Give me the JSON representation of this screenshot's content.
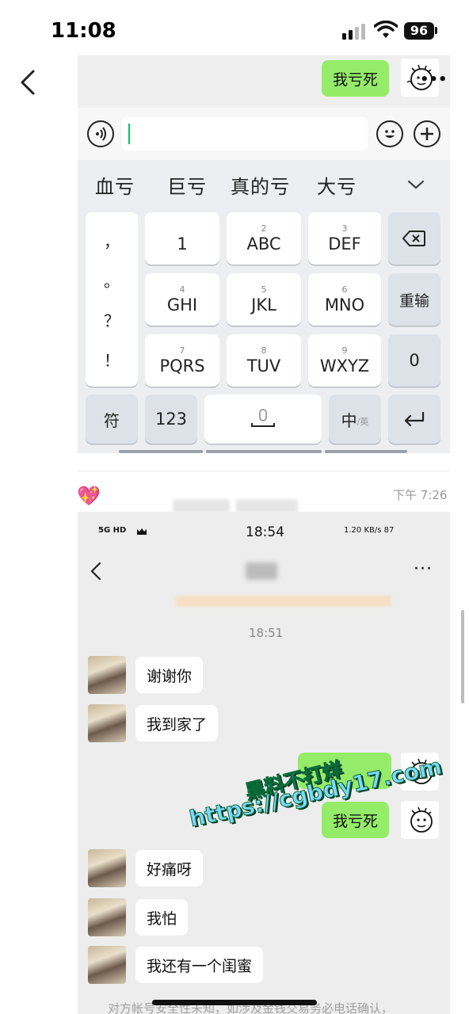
{
  "status_bar": {
    "time": "11:08",
    "battery": "96"
  },
  "top_screenshot": {
    "sent_message": "我亏死",
    "more_icon": "•••",
    "candidates": [
      "血亏",
      "巨亏",
      "真的亏",
      "大亏"
    ],
    "punct_keys": [
      "，",
      "。",
      "？",
      "！"
    ],
    "keys_row1": [
      {
        "num": "",
        "label": "1"
      },
      {
        "num": "2",
        "label": "ABC"
      },
      {
        "num": "3",
        "label": "DEF"
      }
    ],
    "keys_row2": [
      {
        "num": "4",
        "label": "GHI"
      },
      {
        "num": "5",
        "label": "JKL"
      },
      {
        "num": "6",
        "label": "MNO"
      }
    ],
    "keys_row3": [
      {
        "num": "7",
        "label": "PQRS"
      },
      {
        "num": "8",
        "label": "TUV"
      },
      {
        "num": "9",
        "label": "WXYZ"
      }
    ],
    "reinput": "重输",
    "zero": "0",
    "symbol_key": "符",
    "num_key": "123",
    "lang_key": "中",
    "lang_key_alt": "/英"
  },
  "reply": {
    "time": "下午 7:26"
  },
  "bottom_screenshot": {
    "status_time": "18:54",
    "status_left": "5G HD",
    "status_right": "1.20 KB/s 87",
    "more_icon": "···",
    "chat_time": "18:51",
    "messages": [
      {
        "side": "left",
        "text": "谢谢你"
      },
      {
        "side": "left",
        "text": "我到家了"
      },
      {
        "side": "right",
        "text": ""
      },
      {
        "side": "right",
        "text": "我亏死"
      },
      {
        "side": "left",
        "text": "好痛呀"
      },
      {
        "side": "left",
        "text": "我怕"
      },
      {
        "side": "left",
        "text": "我还有一个闺蜜"
      }
    ],
    "footer_note": "对方帐号安全性未知，如涉及金钱交易务必电话确认，"
  },
  "watermark": {
    "line1": "黑料不打烊",
    "line2": "https://cgbdy17.com"
  },
  "colors": {
    "bubble_green": "#95ec69",
    "caret": "#07c160",
    "watermark": "#7ed8ff"
  }
}
